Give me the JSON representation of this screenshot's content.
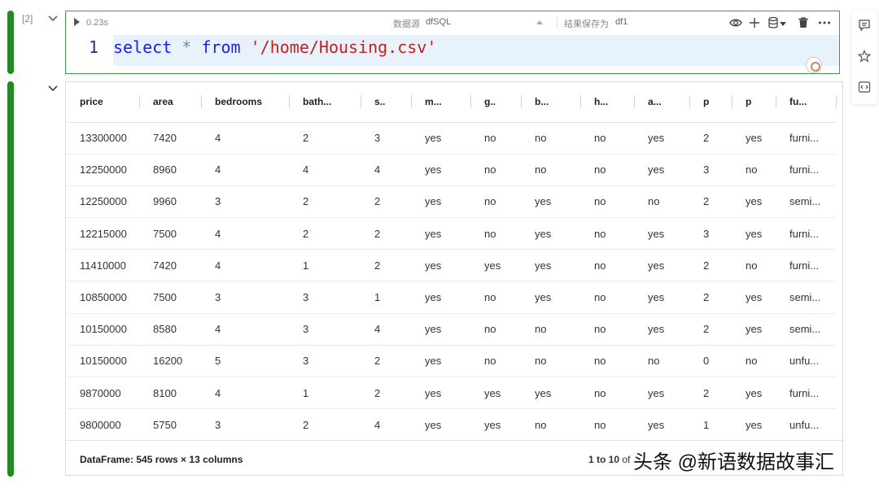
{
  "cell": {
    "index": "[2]",
    "exec_time": "0.23s",
    "datasource_label": "数据源",
    "datasource_value": "dfSQL",
    "save_label": "结果保存为",
    "save_value": "df1",
    "line_number": "1",
    "code_keyword_select": "select",
    "code_star": "*",
    "code_keyword_from": "from",
    "code_string": "'/home/Housing.csv'"
  },
  "toolbar_icons": [
    "play-icon",
    "eye-icon",
    "plus-icon",
    "database-icon",
    "dropdown-caret-icon",
    "trash-icon",
    "more-icon"
  ],
  "side_panel_icons": [
    "comment-icon",
    "star-icon",
    "code-icon"
  ],
  "table": {
    "columns": [
      "price",
      "area",
      "bedrooms",
      "bath...",
      "s..",
      "m...",
      "g..",
      "b...",
      "h...",
      "a...",
      "p",
      "p",
      "fu..."
    ],
    "rows": [
      [
        "13300000",
        "7420",
        "4",
        "2",
        "3",
        "yes",
        "no",
        "no",
        "no",
        "yes",
        "2",
        "yes",
        "furni..."
      ],
      [
        "12250000",
        "8960",
        "4",
        "4",
        "4",
        "yes",
        "no",
        "no",
        "no",
        "yes",
        "3",
        "no",
        "furni..."
      ],
      [
        "12250000",
        "9960",
        "3",
        "2",
        "2",
        "yes",
        "no",
        "yes",
        "no",
        "no",
        "2",
        "yes",
        "semi..."
      ],
      [
        "12215000",
        "7500",
        "4",
        "2",
        "2",
        "yes",
        "no",
        "yes",
        "no",
        "yes",
        "3",
        "yes",
        "furni..."
      ],
      [
        "11410000",
        "7420",
        "4",
        "1",
        "2",
        "yes",
        "yes",
        "yes",
        "no",
        "yes",
        "2",
        "no",
        "furni..."
      ],
      [
        "10850000",
        "7500",
        "3",
        "3",
        "1",
        "yes",
        "no",
        "yes",
        "no",
        "yes",
        "2",
        "yes",
        "semi..."
      ],
      [
        "10150000",
        "8580",
        "4",
        "3",
        "4",
        "yes",
        "no",
        "no",
        "no",
        "yes",
        "2",
        "yes",
        "semi..."
      ],
      [
        "10150000",
        "16200",
        "5",
        "3",
        "2",
        "yes",
        "no",
        "no",
        "no",
        "no",
        "0",
        "no",
        "unfu..."
      ],
      [
        "9870000",
        "8100",
        "4",
        "1",
        "2",
        "yes",
        "yes",
        "yes",
        "no",
        "yes",
        "2",
        "yes",
        "furni..."
      ],
      [
        "9800000",
        "5750",
        "3",
        "2",
        "4",
        "yes",
        "yes",
        "no",
        "no",
        "yes",
        "1",
        "yes",
        "unfu..."
      ]
    ]
  },
  "footer": {
    "info": "DataFrame: 545 rows × 13 columns",
    "pager_range": "1 to 10",
    "pager_of": "of"
  },
  "watermark": "头条 @新语数据故事汇",
  "colors": {
    "run_bar": "#1e8c1e",
    "cell_border": "#3aa23a",
    "keyword": "#1a1aff",
    "string": "#c81e1e",
    "line_highlight": "#e8f2fb"
  }
}
